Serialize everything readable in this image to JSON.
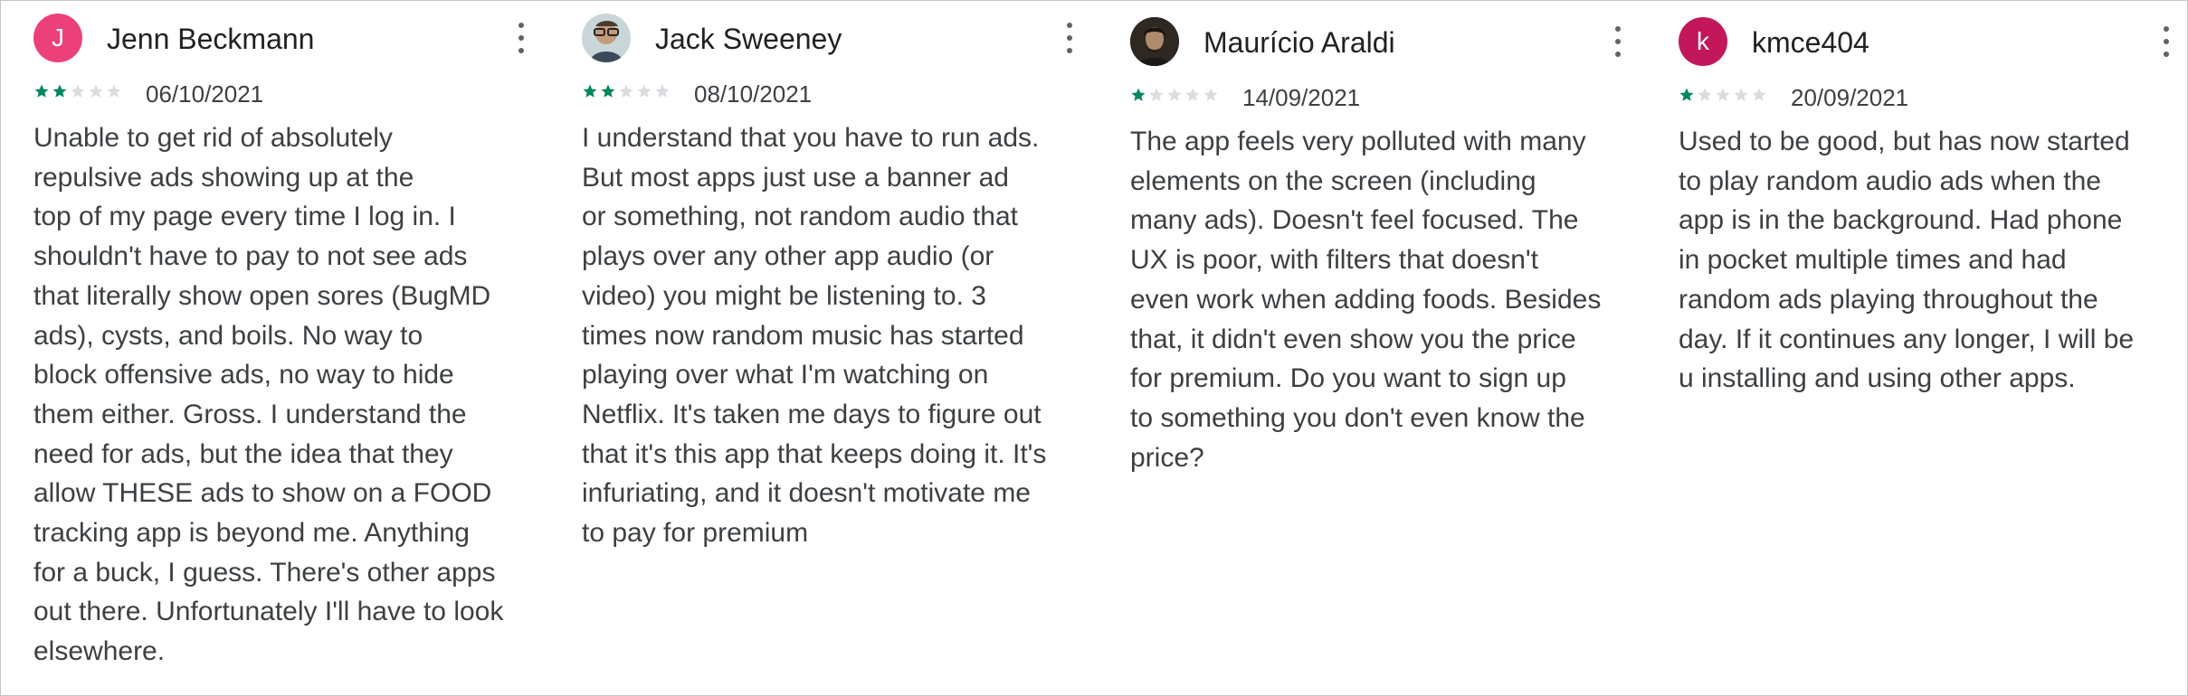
{
  "colors": {
    "star_filled": "#01875f",
    "star_empty": "#dadce0",
    "avatar_jenn": "#ec407a",
    "avatar_kmce": "#c2185b"
  },
  "reviews": [
    {
      "author": "Jenn Beckmann",
      "avatar_initial": "J",
      "rating": 2,
      "date": "06/10/2021",
      "text": "Unable to get rid of absolutely\nrepulsive ads showing up at the\ntop of my page every time I log in. I\nshouldn't have to pay to not see ads\nthat literally show open sores (BugMD\nads), cysts, and boils. No way to\nblock offensive ads, no way to hide\nthem either. Gross. I understand the\nneed for ads, but the idea that they\nallow THESE ads to show on a FOOD\ntracking app is beyond me. Anything\nfor a buck, I guess. There's other apps\nout there. Unfortunately I'll have to look\nelsewhere."
    },
    {
      "author": "Jack Sweeney",
      "avatar_initial": "",
      "rating": 2,
      "date": "08/10/2021",
      "text": "I understand that you have to run ads.\nBut most apps just use a banner ad\nor something, not random audio that\nplays over any other app audio (or\nvideo) you might be listening to. 3\ntimes now random music has started\nplaying over what I'm watching on\nNetflix. It's taken me days to figure out\nthat it's this app that keeps doing it. It's\ninfuriating, and it doesn't motivate me\nto pay for premium"
    },
    {
      "author": "Maurício Araldi",
      "avatar_initial": "",
      "rating": 1,
      "date": "14/09/2021",
      "text": "The app feels very polluted with many\nelements on the screen (including\nmany ads). Doesn't feel focused. The\nUX is poor, with filters that doesn't\neven work when adding foods. Besides\nthat, it didn't even show you the price\nfor premium. Do you want to sign up\nto something you don't even know the\nprice?"
    },
    {
      "author": "kmce404",
      "avatar_initial": "k",
      "rating": 1,
      "date": "20/09/2021",
      "text": "Used to be good, but has now started\nto play random audio ads when the\napp is in the background. Had phone\nin pocket multiple times and had\nrandom ads playing throughout the\nday. If it continues any longer, I will be\nu installing and using other apps."
    }
  ]
}
